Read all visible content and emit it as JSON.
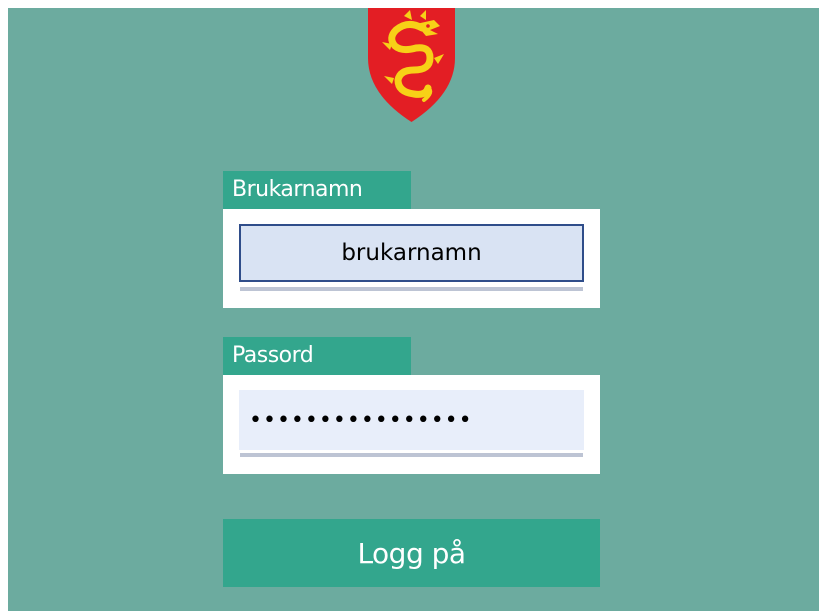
{
  "colors": {
    "background": "#6cab9f",
    "accent": "#33a68d",
    "crest_red": "#e31e24",
    "crest_gold": "#f7d117"
  },
  "header": {
    "crest_icon": "dragon-coat-of-arms-icon"
  },
  "login_form": {
    "username_label": "Brukarnamn",
    "username_value": "brukarnamn",
    "password_label": "Passord",
    "password_value": "••••••••••••••••",
    "submit_label": "Logg på"
  }
}
